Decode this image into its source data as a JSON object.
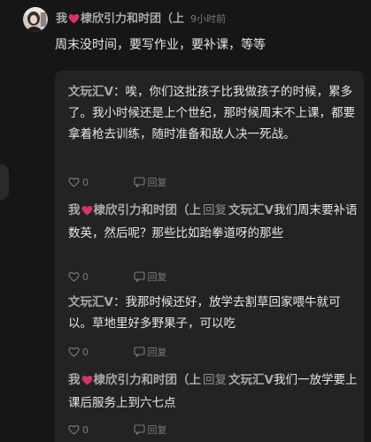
{
  "comment": {
    "author": "我",
    "author_suffix": "棣欣引力和时团（上",
    "time": "9小时前",
    "body": "周末没时间，要写作业，要补课，等等"
  },
  "replies": [
    {
      "author": "文玩汇V",
      "text": "唉，你们这批孩子比我做孩子的时候，累多了。我小时候还是上个世纪，那时候周末不上课，都要拿着枪去训练，随时准备和敌人决一死战。",
      "likes": "0",
      "reply_label": "回复"
    },
    {
      "author": "我",
      "author_suffix": "棣欣引力和时团（上",
      "reply_word": "回复",
      "target": "文玩汇V",
      "text": "我们周末要补语数英，然后呢？那些比如跆拳道呀的那些",
      "likes": "0",
      "reply_label": "回复"
    },
    {
      "author": "文玩汇V",
      "text": "我那时候还好，放学去割草回家喂牛就可以。草地里好多野果子，可以吃",
      "likes": "0",
      "reply_label": "回复"
    },
    {
      "author": "我",
      "author_suffix": "棣欣引力和时团（上",
      "reply_word": "回复",
      "target": "文玩汇V",
      "text": "我们一放学要上课后服务上到六七点",
      "likes": "0",
      "reply_label": "回复"
    }
  ],
  "icons": {
    "heart": "heart-icon",
    "like": "thumbs-up-icon",
    "reply": "comment-icon"
  },
  "colors": {
    "background": "#161616",
    "reply_panel": "#232324",
    "name": "#a9a9ab",
    "text": "#e7e7e9",
    "heart": "#d6336c"
  }
}
